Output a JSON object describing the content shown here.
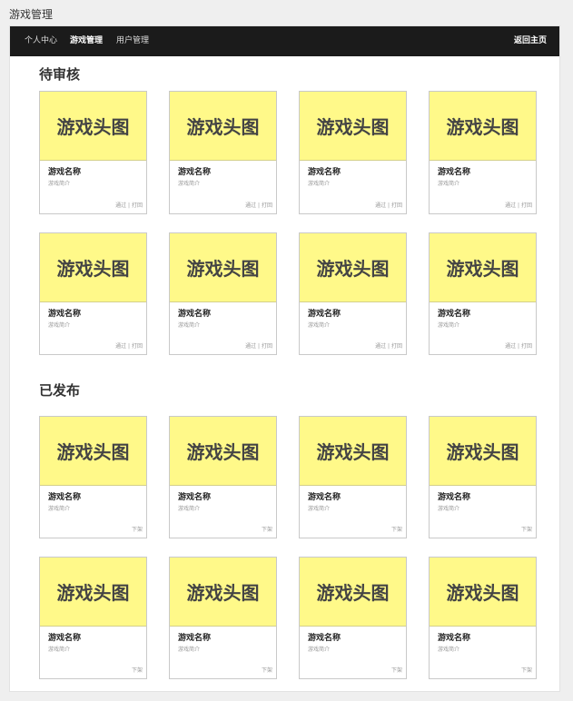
{
  "page_title": "游戏管理",
  "nav": {
    "items": [
      "个人中心",
      "游戏管理",
      "用户管理"
    ],
    "active_index": 1,
    "home_label": "返回主页"
  },
  "sections": [
    {
      "title": "待审核",
      "cards": [
        {
          "head": "游戏头图",
          "name": "游戏名称",
          "desc": "游戏简介",
          "actions": [
            "通过",
            "打回"
          ]
        },
        {
          "head": "游戏头图",
          "name": "游戏名称",
          "desc": "游戏简介",
          "actions": [
            "通过",
            "打回"
          ]
        },
        {
          "head": "游戏头图",
          "name": "游戏名称",
          "desc": "游戏简介",
          "actions": [
            "通过",
            "打回"
          ]
        },
        {
          "head": "游戏头图",
          "name": "游戏名称",
          "desc": "游戏简介",
          "actions": [
            "通过",
            "打回"
          ]
        },
        {
          "head": "游戏头图",
          "name": "游戏名称",
          "desc": "游戏简介",
          "actions": [
            "通过",
            "打回"
          ]
        },
        {
          "head": "游戏头图",
          "name": "游戏名称",
          "desc": "游戏简介",
          "actions": [
            "通过",
            "打回"
          ]
        },
        {
          "head": "游戏头图",
          "name": "游戏名称",
          "desc": "游戏简介",
          "actions": [
            "通过",
            "打回"
          ]
        },
        {
          "head": "游戏头图",
          "name": "游戏名称",
          "desc": "游戏简介",
          "actions": [
            "通过",
            "打回"
          ]
        }
      ]
    },
    {
      "title": "已发布",
      "cards": [
        {
          "head": "游戏头图",
          "name": "游戏名称",
          "desc": "游戏简介",
          "actions": [
            "下架"
          ]
        },
        {
          "head": "游戏头图",
          "name": "游戏名称",
          "desc": "游戏简介",
          "actions": [
            "下架"
          ]
        },
        {
          "head": "游戏头图",
          "name": "游戏名称",
          "desc": "游戏简介",
          "actions": [
            "下架"
          ]
        },
        {
          "head": "游戏头图",
          "name": "游戏名称",
          "desc": "游戏简介",
          "actions": [
            "下架"
          ]
        },
        {
          "head": "游戏头图",
          "name": "游戏名称",
          "desc": "游戏简介",
          "actions": [
            "下架"
          ]
        },
        {
          "head": "游戏头图",
          "name": "游戏名称",
          "desc": "游戏简介",
          "actions": [
            "下架"
          ]
        },
        {
          "head": "游戏头图",
          "name": "游戏名称",
          "desc": "游戏简介",
          "actions": [
            "下架"
          ]
        },
        {
          "head": "游戏头图",
          "name": "游戏名称",
          "desc": "游戏简介",
          "actions": [
            "下架"
          ]
        }
      ]
    }
  ],
  "colors": {
    "navbar": "#1b1b1b",
    "card_head": "#fff989",
    "background": "#efefef"
  }
}
